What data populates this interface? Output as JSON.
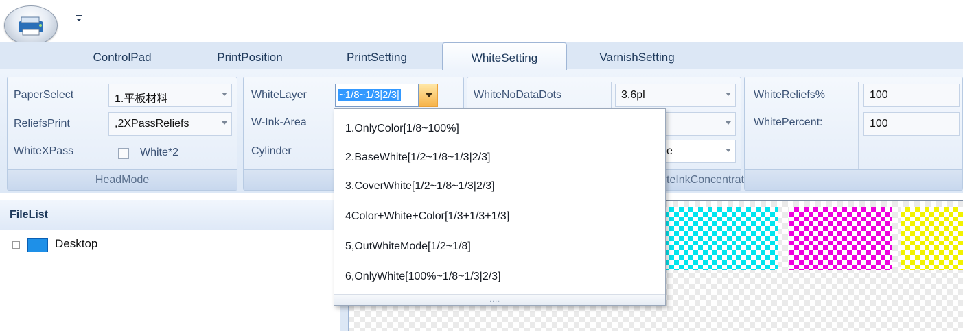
{
  "ribbon": {
    "tabs": [
      {
        "label": "ControlPad"
      },
      {
        "label": "PrintPosition"
      },
      {
        "label": "PrintSetting"
      },
      {
        "label": "WhiteSetting",
        "active": true
      },
      {
        "label": "VarnishSetting"
      }
    ]
  },
  "headmode": {
    "caption": "HeadMode",
    "paper_select_label": "PaperSelect",
    "paper_select_value": "1.平板材料",
    "reliefs_print_label": "ReliefsPrint",
    "reliefs_print_value": ",2XPassReliefs",
    "white_xpass_label": "WhiteXPass",
    "white_x2_label": "White*2",
    "white_x2_checked": false
  },
  "whitelayer_group": {
    "caption_visible": "Wh",
    "white_layer_label": "WhiteLayer",
    "white_layer_value": "~1/8~1/3|2/3|",
    "w_ink_area_label": "W-Ink-Area",
    "cylinder_label": "Cylinder"
  },
  "ink_group": {
    "caption_visible": "teInkConcentration",
    "white_no_data_dots_label": "WhiteNoDataDots",
    "white_no_data_dots_value": "3,6pl",
    "third_combo_visible_text": "e"
  },
  "reliefs_group": {
    "white_reliefs_label": "WhiteReliefs%",
    "white_reliefs_value": "100",
    "white_percent_label": "WhitePercent:",
    "white_percent_value": "100"
  },
  "filelist": {
    "title": "FileList",
    "items": [
      {
        "label": "Desktop"
      }
    ]
  },
  "dropdown": {
    "options": [
      "1.OnlyColor[1/8~100%]",
      "2.BaseWhite[1/2~1/8~1/3|2/3]",
      "3.CoverWhite[1/2~1/8~1/3|2/3]",
      "4Color+White+Color[1/3+1/3+1/3]",
      "5,OutWhiteMode[1/2~1/8]",
      "6,OnlyWhite[100%~1/8~1/3|2/3]"
    ],
    "grip": "...."
  },
  "colors": {
    "accent": "#3399ff",
    "swatch_cyan": "#00e5ee",
    "swatch_magenta": "#ee00dd",
    "swatch_yellow": "#f2f200"
  }
}
